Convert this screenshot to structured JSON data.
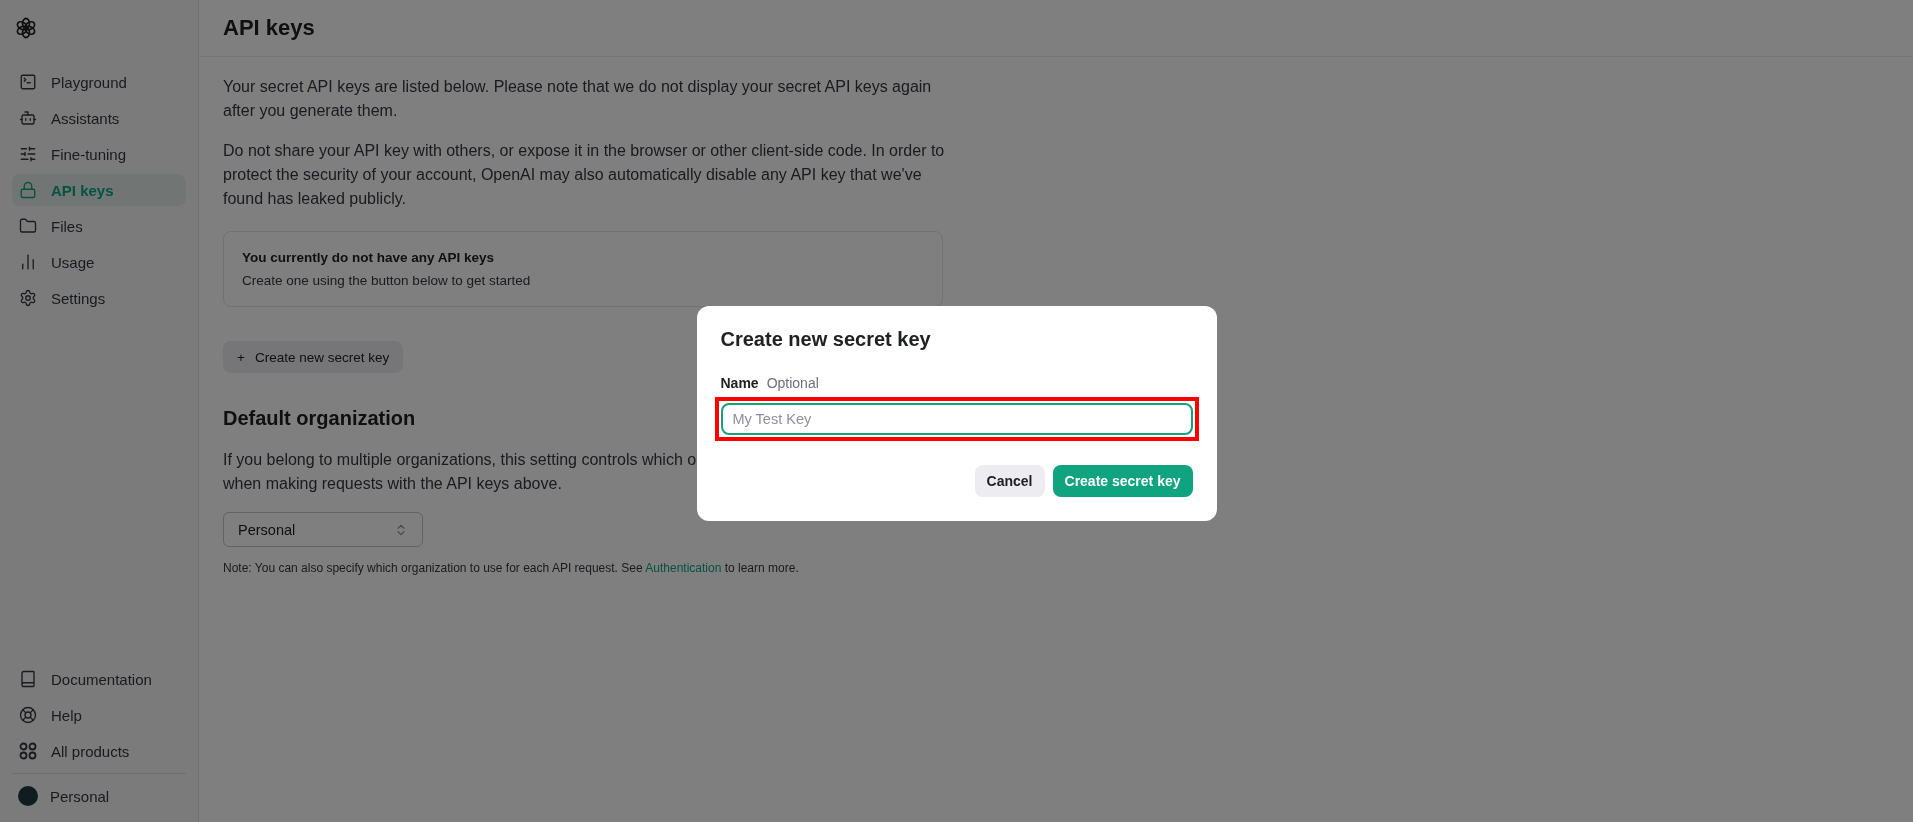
{
  "sidebar": {
    "items": [
      {
        "label": "Playground",
        "selected": false
      },
      {
        "label": "Assistants",
        "selected": false
      },
      {
        "label": "Fine-tuning",
        "selected": false
      },
      {
        "label": "API keys",
        "selected": true
      },
      {
        "label": "Files",
        "selected": false
      },
      {
        "label": "Usage",
        "selected": false
      },
      {
        "label": "Settings",
        "selected": false
      }
    ],
    "footer_items": [
      {
        "label": "Documentation"
      },
      {
        "label": "Help"
      },
      {
        "label": "All products"
      }
    ],
    "account": {
      "label": "Personal"
    }
  },
  "page": {
    "title": "API keys",
    "paragraphs": [
      "Your secret API keys are listed below. Please note that we do not display your secret API keys again after you generate them.",
      "Do not share your API key with others, or expose it in the browser or other client-side code. In order to protect the security of your account, OpenAI may also automatically disable any API key that we've found has leaked publicly."
    ],
    "empty_card": {
      "title": "You currently do not have any API keys",
      "text": "Create one using the button below to get started"
    },
    "create_button": {
      "icon": "+",
      "label": "Create new secret key"
    },
    "org_section": {
      "title": "Default organization",
      "text_lines": [
        "If you belong to multiple organizations, this setting controls which o",
        "when making requests with the API keys above."
      ],
      "select": {
        "value": "Personal"
      },
      "note_before": "Note: You can also specify which organization to use for each API request. See ",
      "note_link": "Authentication",
      "note_after": " to learn more."
    }
  },
  "dialog": {
    "title": "Create new secret key",
    "field": {
      "label": "Name",
      "hint": "Optional",
      "placeholder": "My Test Key",
      "focused": true,
      "highlighted": true
    },
    "buttons": [
      {
        "label": "Cancel",
        "kind": "secondary"
      },
      {
        "label": "Create secret key",
        "kind": "primary"
      }
    ]
  }
}
